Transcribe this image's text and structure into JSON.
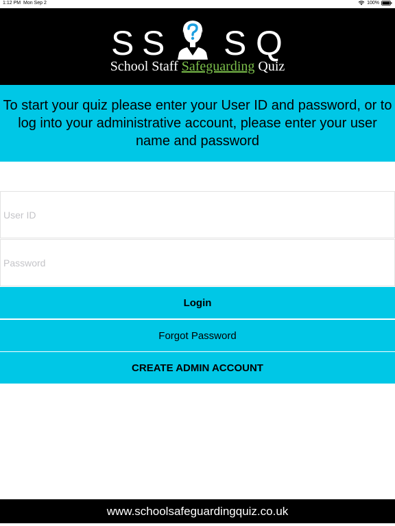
{
  "status_bar": {
    "time": "1:12 PM",
    "date": "Mon Sep 2",
    "battery": "100%"
  },
  "header": {
    "logo_letters": [
      "S",
      "S",
      "S",
      "Q"
    ],
    "tagline_pre": "School Staff ",
    "tagline_accent": "Safeguarding",
    "tagline_post": " Quiz"
  },
  "instruction": {
    "text": "To start your quiz please enter your User ID and password, or to log into your administrative account, please enter your user name and password"
  },
  "form": {
    "user_id_placeholder": "User ID",
    "password_placeholder": "Password",
    "user_id_value": "",
    "password_value": ""
  },
  "buttons": {
    "login": "Login",
    "forgot_password": "Forgot Password",
    "create_admin": "CREATE ADMIN ACCOUNT"
  },
  "footer": {
    "url_text": "www.schoolsafeguardingquiz.co.uk"
  },
  "colors": {
    "accent": "#00c7e6",
    "header_bg": "#000000",
    "tagline_green": "#7cc04b"
  },
  "icons": {
    "wifi": "wifi-icon",
    "battery": "battery-icon",
    "logo_person": "person-question-icon"
  }
}
